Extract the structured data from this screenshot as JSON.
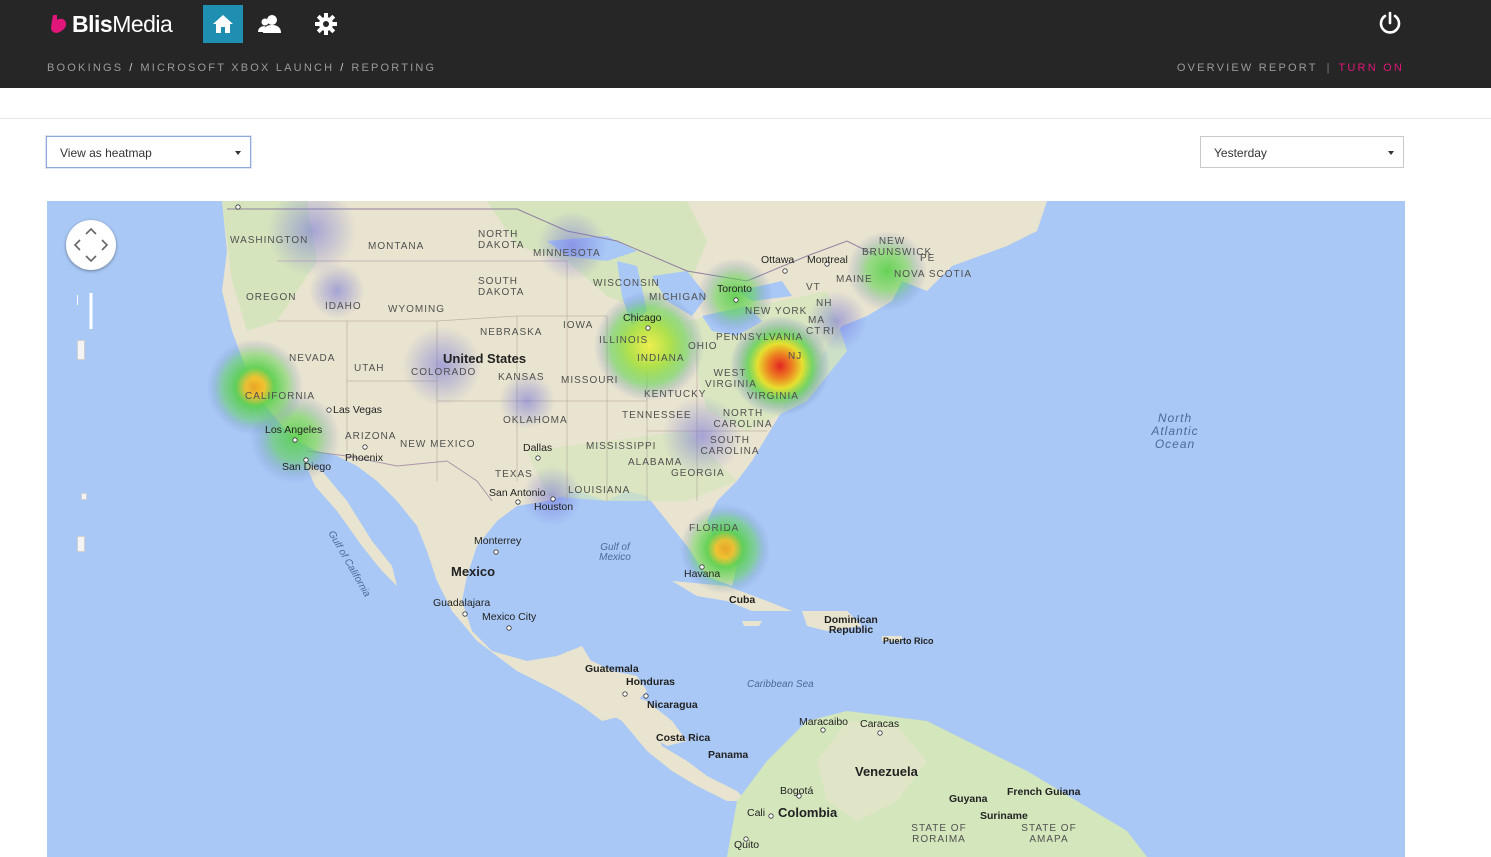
{
  "app": {
    "brand_bold": "Blis",
    "brand_light": "Media",
    "brand_color": "#e0167a",
    "nav_icons": [
      "home-icon",
      "users-icon",
      "gear-icon"
    ],
    "power_icon": "power-icon"
  },
  "breadcrumb": {
    "items": [
      "BOOKINGS",
      "MICROSOFT XBOX LAUNCH",
      "REPORTING"
    ],
    "separator": "/"
  },
  "header_links": {
    "overview": "OVERVIEW REPORT",
    "separator": "|",
    "turn_on": "TURN ON"
  },
  "controls": {
    "view_select": "View as heatmap",
    "date_select": "Yesterday"
  },
  "map": {
    "countries": [
      "United States",
      "Mexico",
      "Venezuela",
      "Colombia"
    ],
    "regions": [
      "WASHINGTON",
      "MONTANA",
      "NORTH DAKOTA",
      "MINNESOTA",
      "SOUTH DAKOTA",
      "OREGON",
      "IDAHO",
      "WYOMING",
      "WISCONSIN",
      "MICHIGAN",
      "NEBRASKA",
      "IOWA",
      "ILLINOIS",
      "INDIANA",
      "OHIO",
      "NEVADA",
      "UTAH",
      "COLORADO",
      "KANSAS",
      "MISSOURI",
      "CALIFORNIA",
      "OKLAHOMA",
      "ARIZONA",
      "NEW MEXICO",
      "KENTUCKY",
      "TENNESSEE",
      "TEXAS",
      "LOUISIANA",
      "MISSISSIPPI",
      "ALABAMA",
      "GEORGIA",
      "FLORIDA",
      "WEST VIRGINIA",
      "VIRGINIA",
      "NORTH CAROLINA",
      "SOUTH CAROLINA",
      "PENNSYLVANIA",
      "NEW YORK",
      "MA",
      "CT",
      "RI",
      "NH",
      "VT",
      "MAINE",
      "NEW BRUNSWICK",
      "NOVA SCOTIA",
      "PE",
      "NJ",
      "STATE OF RORAIMA",
      "STATE OF AMAPA"
    ],
    "cities": [
      "Ottawa",
      "Montreal",
      "Toronto",
      "Chicago",
      "Las Vegas",
      "Los Angeles",
      "Phoenix",
      "San Diego",
      "Dallas",
      "San Antonio",
      "Houston",
      "Monterrey",
      "Guadalajara",
      "Mexico City",
      "Havana",
      "Cuba",
      "Dominican Republic",
      "Puerto Rico",
      "Guatemala",
      "Honduras",
      "Nicaragua",
      "Costa Rica",
      "Panama",
      "Maracaibo",
      "Caracas",
      "Bogotá",
      "Cali",
      "Guyana",
      "French Guiana",
      "Suriname",
      "Quito"
    ],
    "water": [
      "Gulf of Mexico",
      "Caribbean Sea",
      "Gulf of California",
      "North Atlantic Ocean"
    ],
    "heat_colors": {
      "low": "#6b6bd8",
      "mid": "#58d04a",
      "high": "#f0e020",
      "peak": "#e41010"
    },
    "heatmap_points": [
      {
        "place": "Los Angeles",
        "intensity": 0.55
      },
      {
        "place": "San Francisco",
        "intensity": 0.75
      },
      {
        "place": "Chicago",
        "intensity": 0.7
      },
      {
        "place": "New York",
        "intensity": 1.0
      },
      {
        "place": "Toronto",
        "intensity": 0.5
      },
      {
        "place": "Miami",
        "intensity": 0.8
      },
      {
        "place": "Halifax",
        "intensity": 0.4
      },
      {
        "place": "Seattle",
        "intensity": 0.2
      },
      {
        "place": "Denver",
        "intensity": 0.2
      },
      {
        "place": "Houston",
        "intensity": 0.15
      },
      {
        "place": "Atlanta",
        "intensity": 0.2
      }
    ]
  }
}
